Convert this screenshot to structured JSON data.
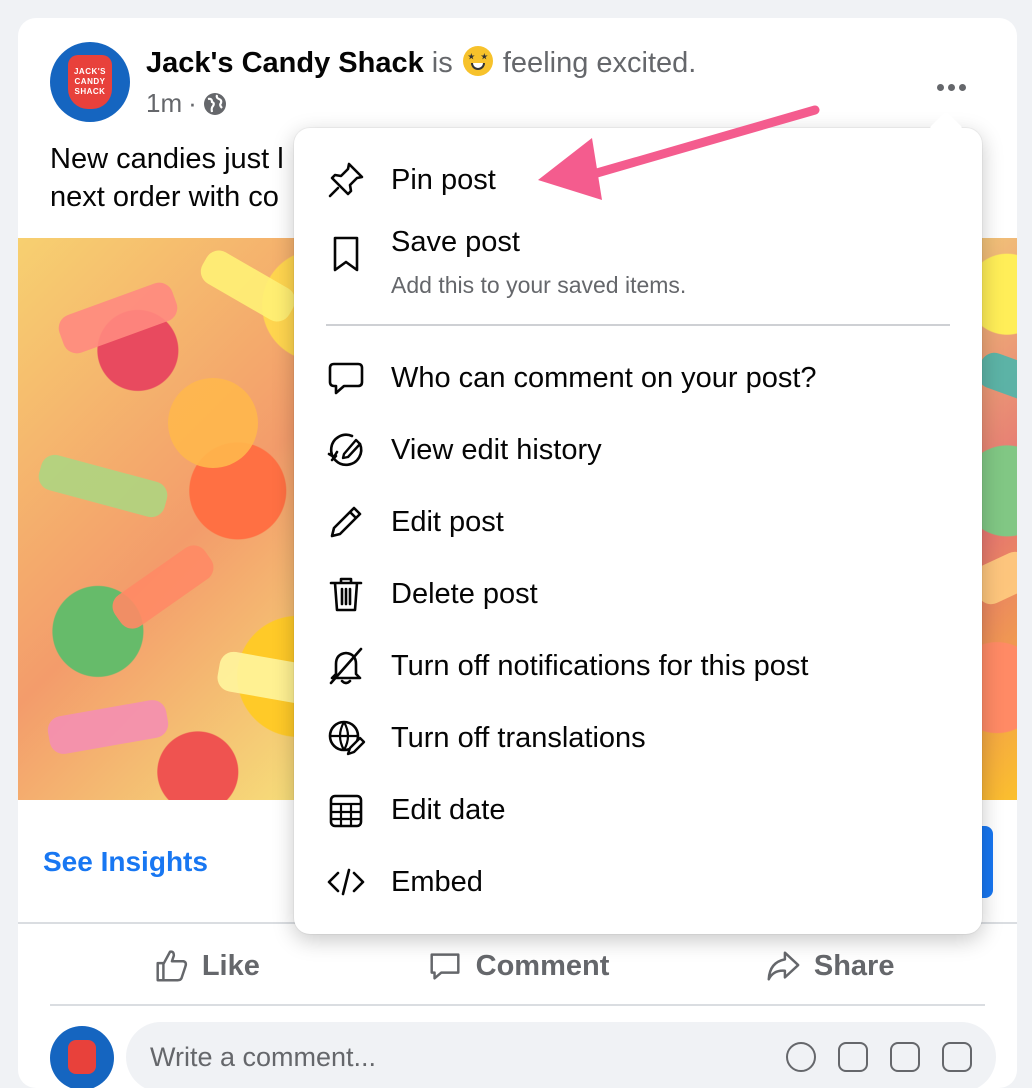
{
  "post": {
    "avatar_text_lines": [
      "JACK'S",
      "CANDY",
      "SHACK"
    ],
    "author": "Jack's Candy Shack",
    "verb": "is",
    "feeling": "feeling excited.",
    "time": "1m",
    "separator": "·",
    "audience_icon": "globe-icon",
    "text": "New candies just l\nnext order with co"
  },
  "insights": {
    "link_label": "See Insights"
  },
  "actions": {
    "like": "Like",
    "comment": "Comment",
    "share": "Share"
  },
  "comment_box": {
    "placeholder": "Write a comment..."
  },
  "menu": {
    "items": [
      {
        "icon": "pin-icon",
        "label": "Pin post"
      },
      {
        "icon": "bookmark-icon",
        "label": "Save post",
        "sublabel": "Add this to your saved items."
      },
      {
        "icon": "comment-bubble-icon",
        "label": "Who can comment on your post?"
      },
      {
        "icon": "edit-history-icon",
        "label": "View edit history"
      },
      {
        "icon": "pencil-icon",
        "label": "Edit post"
      },
      {
        "icon": "trash-icon",
        "label": "Delete post"
      },
      {
        "icon": "bell-off-icon",
        "label": "Turn off notifications for this post"
      },
      {
        "icon": "globe-translate-icon",
        "label": "Turn off translations"
      },
      {
        "icon": "calendar-icon",
        "label": "Edit date"
      },
      {
        "icon": "code-icon",
        "label": "Embed"
      }
    ]
  },
  "colors": {
    "accent": "#1877f2",
    "annotation_arrow": "#f45c8e",
    "secondary_text": "#65676b"
  }
}
